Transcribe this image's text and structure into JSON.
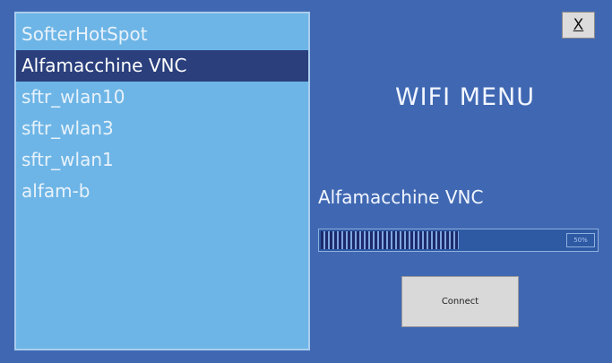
{
  "networks": [
    {
      "label": "SofterHotSpot",
      "selected": false
    },
    {
      "label": "Alfamacchine VNC",
      "selected": true
    },
    {
      "label": "sftr_wlan10",
      "selected": false
    },
    {
      "label": "sftr_wlan3",
      "selected": false
    },
    {
      "label": "sftr_wlan1",
      "selected": false
    },
    {
      "label": "alfam-b",
      "selected": false
    }
  ],
  "header": {
    "title": "WIFI MENU",
    "close_label": "X"
  },
  "status": {
    "selected_network": "Alfamacchine VNC",
    "progress_percent": 50,
    "progress_text": "50%"
  },
  "actions": {
    "connect_label": "Connect"
  },
  "colors": {
    "background": "#4068b2",
    "list_background": "#6db5e6",
    "selected_row": "#2a3f7c",
    "progress_fill": "#1c2a6b",
    "button": "#d9d9d9"
  }
}
